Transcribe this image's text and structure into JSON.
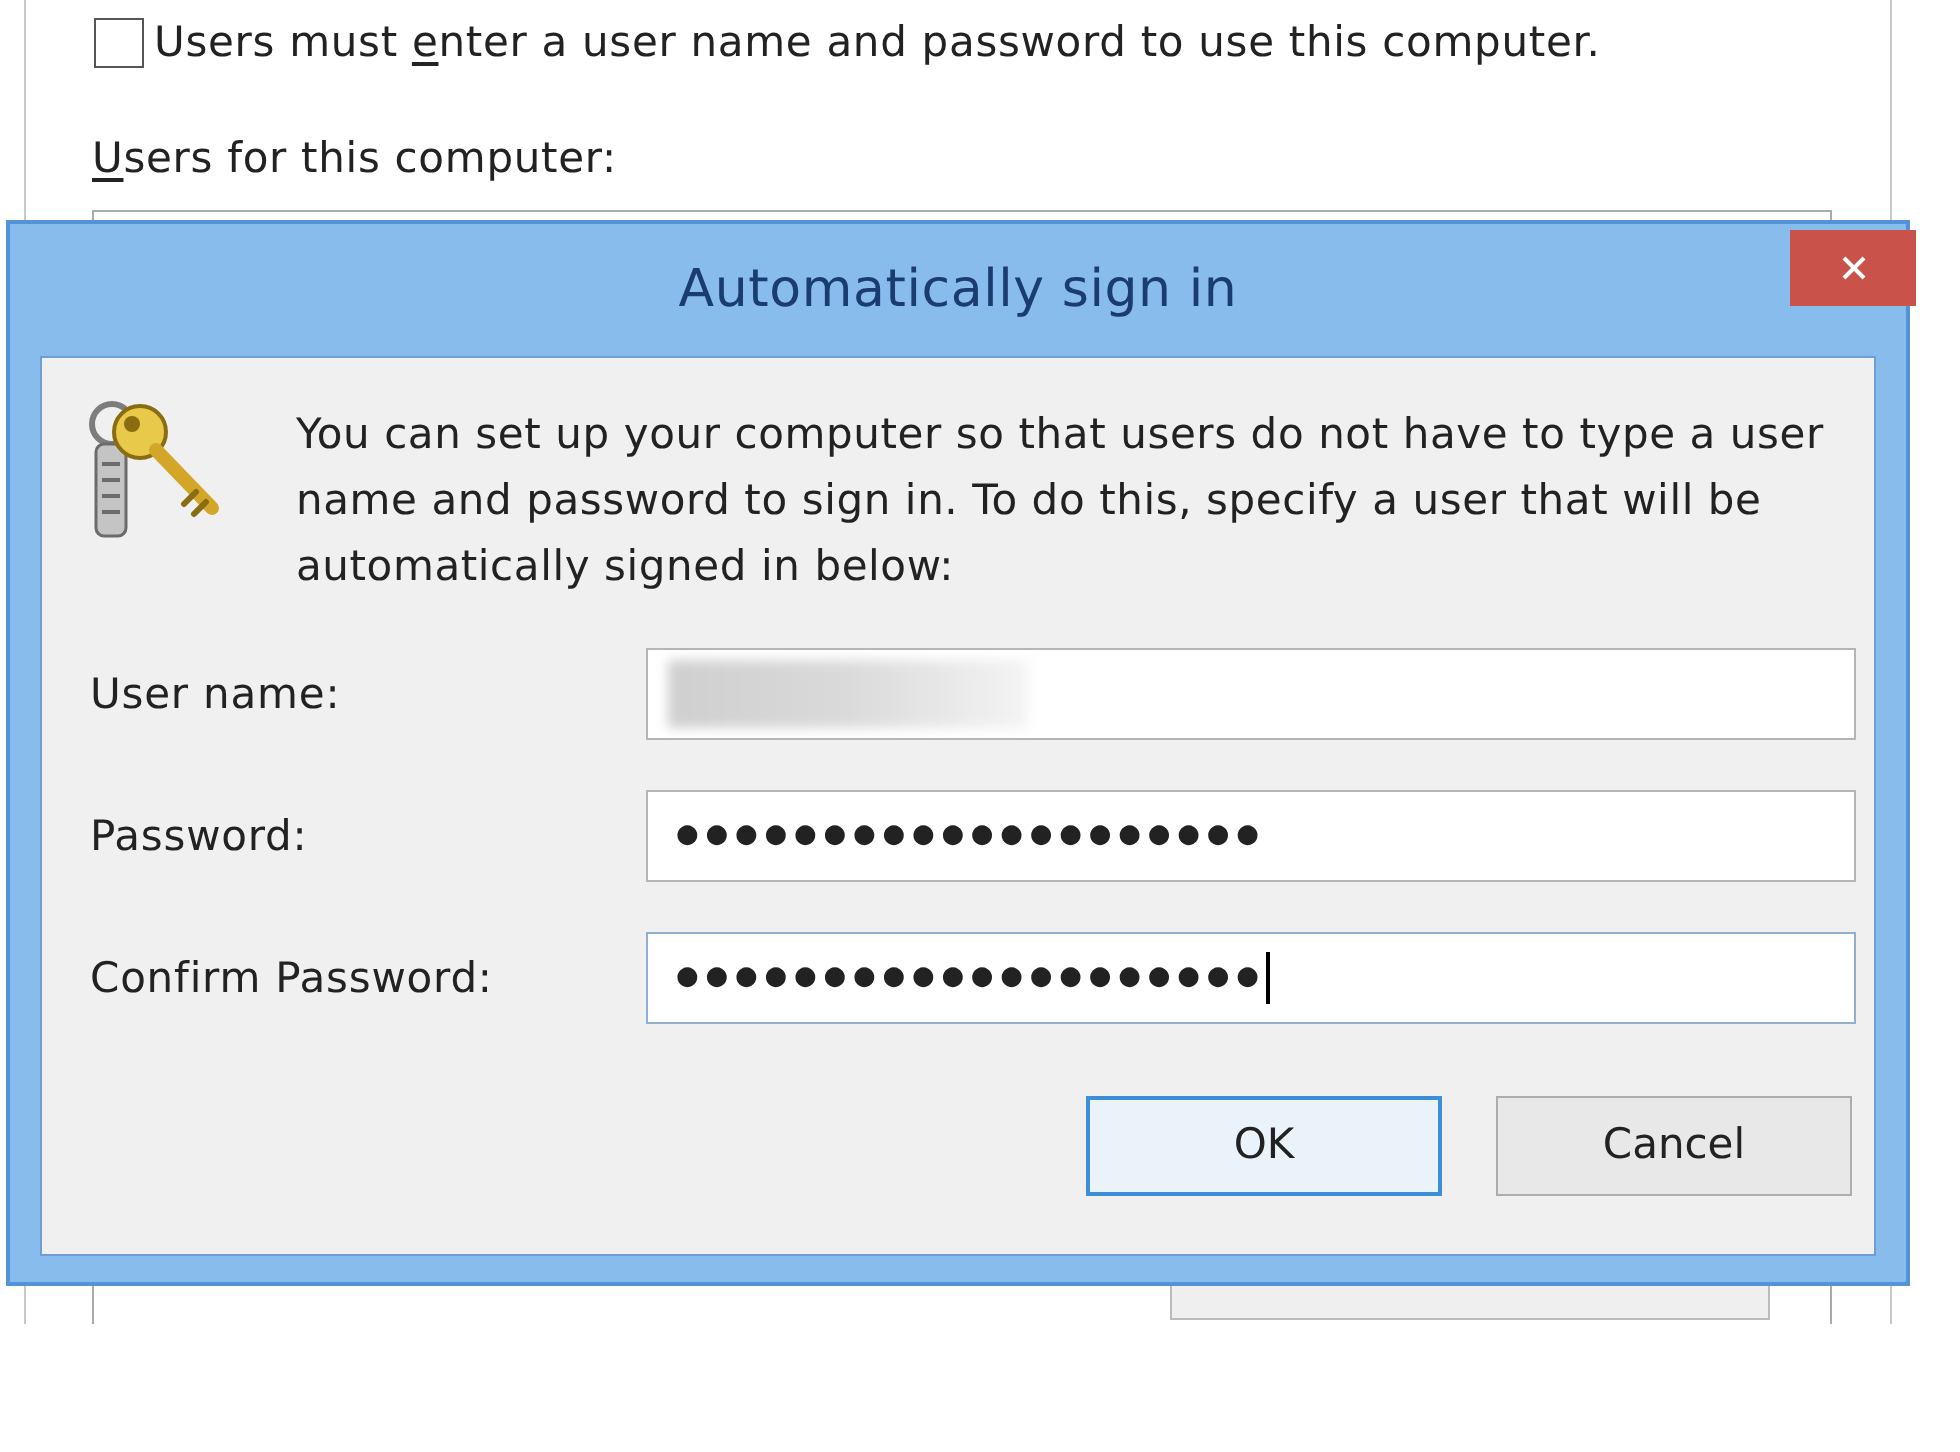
{
  "background_window": {
    "checkbox": {
      "label": "Users must enter a user name and password to use this computer.",
      "checked": false
    },
    "list_label": {
      "text": "Users for this computer:"
    }
  },
  "dialog": {
    "title": "Automatically sign in",
    "description": "You can set up your computer so that users do not have to type a user name and password to sign in. To do this, specify a user that will be automatically signed in below:",
    "fields": [
      {
        "label": "User name:",
        "redacted": true,
        "focused": false
      },
      {
        "label": "Password:",
        "value": "●●●●●●●●●●●●●●●●●●●●",
        "redacted": false,
        "focused": false
      },
      {
        "label": "Confirm Password:",
        "value": "●●●●●●●●●●●●●●●●●●●●",
        "redacted": false,
        "focused": true
      }
    ],
    "buttons": [
      {
        "label": "OK",
        "default": true
      },
      {
        "label": "Cancel",
        "default": false
      }
    ]
  }
}
